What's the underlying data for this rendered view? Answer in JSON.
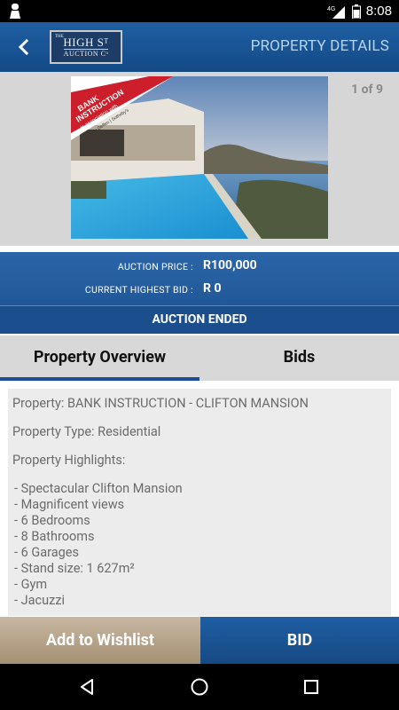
{
  "status_bar": {
    "time": "8:08",
    "network": "4G",
    "icons": [
      "notification-icon",
      "signal-icon",
      "battery-icon"
    ]
  },
  "app_bar": {
    "back_icon": "back-arrow-icon",
    "logo": {
      "line0": "THE",
      "line1": "HIGH Sᵀ",
      "line2": "AUCTION Cᵒ"
    },
    "title": "PROPERTY DETAILS"
  },
  "gallery": {
    "counter": "1 of 9",
    "banner_line1": "BANK",
    "banner_line2": "INSTRUCTION",
    "banner_line3": "in association with",
    "banner_line4": "Lew Geffen | Sotheby's"
  },
  "auction": {
    "price_label": "AUCTION PRICE :",
    "price_value": "R100,000",
    "bid_label": "CURRENT HIGHEST BID :",
    "bid_value": "R 0",
    "status": "AUCTION ENDED"
  },
  "tabs": [
    {
      "label": "Property Overview",
      "active": true
    },
    {
      "label": "Bids",
      "active": false
    }
  ],
  "overview": {
    "property": "Property: BANK INSTRUCTION - CLIFTON MANSION",
    "type": "Property Type: Residential",
    "highlights_label": "Property Highlights:",
    "highlights": [
      "- Spectacular Clifton Mansion",
      "- Magnificent views",
      "- 6 Bedrooms",
      "- 8 Bathrooms",
      "- 6 Garages",
      "- Stand size: 1 627m²",
      "- Gym",
      "- Jacuzzi"
    ]
  },
  "buttons": {
    "wishlist": "Add to Wishlist",
    "bid": "BID"
  },
  "colors": {
    "primary": "#1b4f91",
    "wishlist": "#b5a389",
    "content_bg": "#ececec"
  }
}
